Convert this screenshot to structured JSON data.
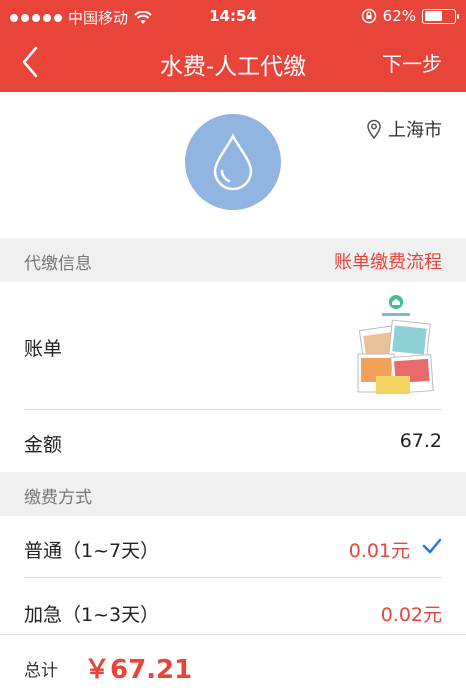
{
  "status_bar": {
    "carrier": "中国移动",
    "time": "14:54",
    "battery": "62%",
    "battery_level": 0.62,
    "icons": [
      "signal-dots-icon",
      "wifi-icon",
      "rotation-lock-icon",
      "battery-icon"
    ]
  },
  "navbar": {
    "back_icon": "chevron-left-icon",
    "title": "水费-人工代缴",
    "next_label": "下一步"
  },
  "hero": {
    "icon": "water-drop-icon",
    "location_icon": "location-pin-icon",
    "location": "上海市"
  },
  "section_info": {
    "title": "代缴信息",
    "link": "账单缴费流程"
  },
  "bill_row": {
    "label": "账单",
    "thumbnail_icon": "bill-image-icon"
  },
  "amount_row": {
    "label": "金额",
    "value": "67.2"
  },
  "section_payment": {
    "title": "缴费方式"
  },
  "payment_options": [
    {
      "label": "普通（1~7天）",
      "price": "0.01元",
      "selected": true
    },
    {
      "label": "加急（1~3天）",
      "price": "0.02元",
      "selected": false
    }
  ],
  "total": {
    "label": "总计",
    "amount": "￥67.21"
  },
  "colors": {
    "brand_red": "#e8443a",
    "water_blue": "#8fb5e0",
    "check_blue": "#1a7be8"
  }
}
